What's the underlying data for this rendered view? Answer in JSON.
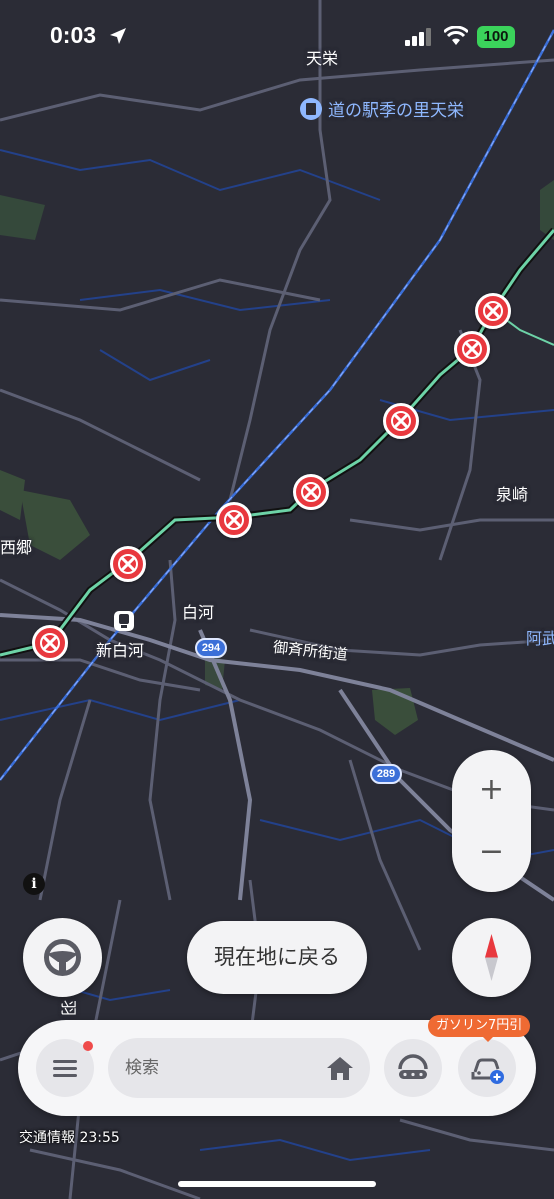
{
  "status_bar": {
    "time": "0:03",
    "battery": "100"
  },
  "map": {
    "labels": {
      "tenei": "天栄",
      "michi_no_eki": "道の駅季の里天栄",
      "izumizaki": "泉崎",
      "nishigo": "西郷",
      "shirakawa": "白河",
      "shin_shirakawa": "新白河",
      "onari_kaido": "御斉所街道",
      "abukuma": "阿武",
      "side_label": "羽"
    },
    "route_shields": {
      "r294": "294",
      "r289": "289"
    },
    "colors": {
      "background": "#2b2c36",
      "closure": "#e8383e",
      "highway": "#6dd3a7",
      "rail": "#3b6fd8"
    }
  },
  "controls": {
    "zoom_in": "+",
    "zoom_out": "−",
    "return_to_location": "現在地に戻る"
  },
  "bottom_bar": {
    "search_placeholder": "検索",
    "promo_badge": "ガソリン7円引"
  },
  "traffic_info": "交通情報 23:55",
  "icons": [
    "location-arrow-icon",
    "signal-icon",
    "wifi-icon",
    "steering-wheel-icon",
    "compass-icon",
    "menu-icon",
    "home-icon",
    "route-icon",
    "car-add-icon",
    "info-icon",
    "train-station-icon",
    "road-closure-icon"
  ]
}
